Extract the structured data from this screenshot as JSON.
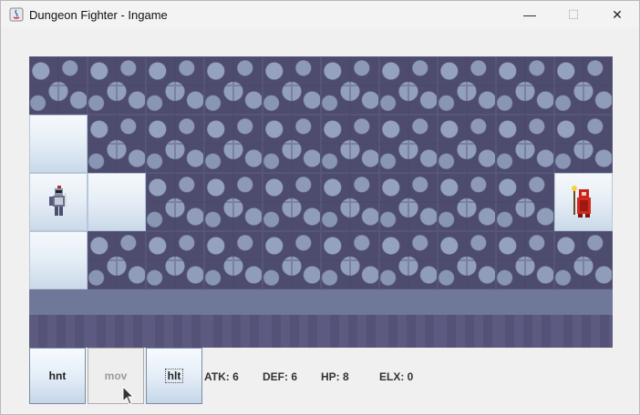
{
  "window": {
    "title": "Dungeon Fighter - Ingame",
    "controls": {
      "minimize": "—",
      "maximize": "☐",
      "close": "✕"
    }
  },
  "board": {
    "rows": [
      [
        "stone",
        "stone",
        "stone",
        "stone",
        "stone",
        "stone",
        "stone",
        "stone",
        "stone",
        "stone"
      ],
      [
        "floor",
        "stone",
        "stone",
        "stone",
        "stone",
        "stone",
        "stone",
        "stone",
        "stone",
        "stone"
      ],
      [
        "floor",
        "floor",
        "stone",
        "stone",
        "stone",
        "stone",
        "stone",
        "stone",
        "stone",
        "floor"
      ],
      [
        "floor",
        "stone",
        "stone",
        "stone",
        "stone",
        "stone",
        "stone",
        "stone",
        "stone",
        "stone"
      ],
      [
        "wall",
        "wall",
        "wall",
        "wall",
        "wall",
        "wall",
        "wall",
        "wall",
        "wall",
        "wall"
      ]
    ],
    "player": {
      "row": 2,
      "col": 0,
      "icon": "knight-icon"
    },
    "enemy": {
      "row": 2,
      "col": 9,
      "icon": "red-mage-icon"
    }
  },
  "actions": {
    "hunt": "hnt",
    "move": "mov",
    "halt": "hlt"
  },
  "stats": {
    "atk": "ATK: 6",
    "def": "DEF: 6",
    "hp": "HP: 8",
    "elx": "ELX: 0"
  }
}
